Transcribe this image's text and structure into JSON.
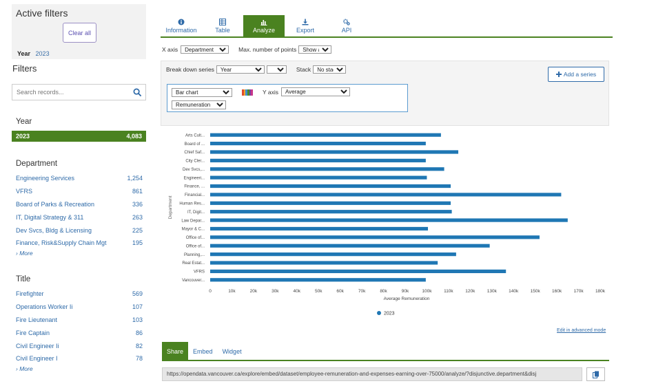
{
  "active_filters": {
    "title": "Active filters",
    "clear_label": "Clear all",
    "chip_key": "Year",
    "chip_value": "2023"
  },
  "filters": {
    "title": "Filters",
    "search_placeholder": "Search records...",
    "year": {
      "title": "Year",
      "items": [
        {
          "label": "2023",
          "count": "4,083"
        }
      ]
    },
    "department": {
      "title": "Department",
      "items": [
        {
          "label": "Engineering Services",
          "count": "1,254"
        },
        {
          "label": "VFRS",
          "count": "861"
        },
        {
          "label": "Board of Parks & Recreation",
          "count": "336"
        },
        {
          "label": "IT, Digital Strategy & 311",
          "count": "263"
        },
        {
          "label": "Dev Svcs, Bldg & Licensing",
          "count": "225"
        },
        {
          "label": "Finance, Risk&Supply Chain Mgt",
          "count": "195"
        }
      ],
      "more_label": "› More"
    },
    "title_facet": {
      "title": "Title",
      "items": [
        {
          "label": "Firefighter",
          "count": "569"
        },
        {
          "label": "Operations Worker Ii",
          "count": "107"
        },
        {
          "label": "Fire Lieutenant",
          "count": "103"
        },
        {
          "label": "Fire Captain",
          "count": "86"
        },
        {
          "label": "Civil Engineer Ii",
          "count": "82"
        },
        {
          "label": "Civil Engineer I",
          "count": "78"
        }
      ],
      "more_label": "› More"
    }
  },
  "tabs": [
    {
      "label": "Information",
      "icon": "info-icon"
    },
    {
      "label": "Table",
      "icon": "table-icon"
    },
    {
      "label": "Analyze",
      "icon": "bar-chart-icon",
      "active": true
    },
    {
      "label": "Export",
      "icon": "download-icon"
    },
    {
      "label": "API",
      "icon": "cogs-icon"
    }
  ],
  "controls": {
    "x_axis_label": "X axis",
    "x_axis_value": "Department",
    "max_points_label": "Max. number of points",
    "max_points_value": "Show all",
    "break_down_label": "Break down series",
    "break_down_value": "Year",
    "break_down_second": "",
    "stack_label": "Stack",
    "stack_value": "No stack",
    "add_series_label": "Add a series",
    "chart_type_value": "Bar chart",
    "y_axis_label": "Y axis",
    "y_axis_value": "Average",
    "y_field_value": "Remuneration"
  },
  "palette_colors": [
    "#e04d2b",
    "#f0a330",
    "#3d8fcf",
    "#4a8a2a",
    "#7a3fa0",
    "#c7378a"
  ],
  "chart_data": {
    "type": "bar",
    "orientation": "horizontal",
    "categories": [
      "Arts Cult...",
      "Board of ...",
      "Chief Saf...",
      "City Cler...",
      "Dev Svcs,...",
      "Engineeri...",
      "Finance, ...",
      "Financial...",
      "Human Res...",
      "IT, Digit...",
      "Law Depar...",
      "Mayor & C...",
      "Office of...",
      "Office of...",
      "Planning,...",
      "Real Estat...",
      "VFRS",
      "Vancouver..."
    ],
    "series": [
      {
        "name": "2023",
        "color": "#1f77b4",
        "values": [
          106500,
          99500,
          114500,
          99500,
          108000,
          100000,
          111000,
          162000,
          111000,
          111500,
          165000,
          100500,
          152000,
          129000,
          113500,
          105000,
          136500,
          99500
        ]
      }
    ],
    "xlabel": "Average Remuneration",
    "ylabel": "Department",
    "xlim": [
      0,
      180000
    ],
    "ticks": [
      "0",
      "10k",
      "20k",
      "30k",
      "40k",
      "50k",
      "60k",
      "70k",
      "80k",
      "90k",
      "100k",
      "110k",
      "120k",
      "130k",
      "140k",
      "150k",
      "160k",
      "170k",
      "180k"
    ],
    "legend_position": "bottom",
    "grid": false
  },
  "edit_advanced_label": "Edit in advanced mode",
  "share": {
    "tabs": [
      {
        "label": "Share",
        "active": true
      },
      {
        "label": "Embed"
      },
      {
        "label": "Widget"
      }
    ],
    "url": "https://opendata.vancouver.ca/explore/embed/dataset/employee-remuneration-and-expenses-earning-over-75000/analyze/?disjunctive.department&disj"
  }
}
